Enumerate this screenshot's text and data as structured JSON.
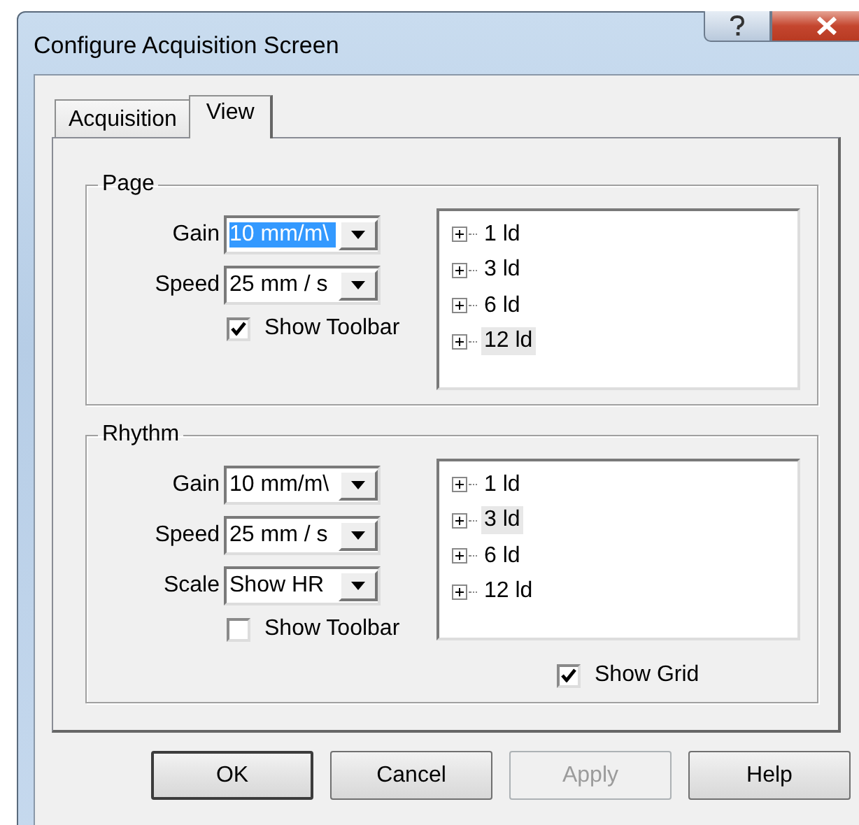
{
  "window": {
    "title": "Configure Acquisition Screen"
  },
  "tabs": [
    {
      "label": "Acquisition",
      "selected": false
    },
    {
      "label": "View",
      "selected": true
    }
  ],
  "groups": [
    {
      "title": "Page",
      "fields": [
        {
          "label": "Gain",
          "value": "10 mm/m\\",
          "focused": true
        },
        {
          "label": "Speed",
          "value": "25 mm / s",
          "focused": false
        }
      ],
      "show_toolbar": {
        "label": "Show Toolbar",
        "checked": true
      },
      "tree": [
        {
          "label": "1 ld",
          "expanded": false,
          "selected": false
        },
        {
          "label": "3 ld",
          "expanded": false,
          "selected": false
        },
        {
          "label": "6 ld",
          "expanded": false,
          "selected": false
        },
        {
          "label": "12 ld",
          "expanded": false,
          "selected": true
        }
      ]
    },
    {
      "title": "Rhythm",
      "fields": [
        {
          "label": "Gain",
          "value": "10 mm/m\\",
          "focused": false
        },
        {
          "label": "Speed",
          "value": "25 mm / s",
          "focused": false
        },
        {
          "label": "Scale",
          "value": "Show HR",
          "focused": false
        }
      ],
      "show_toolbar": {
        "label": "Show Toolbar",
        "checked": false
      },
      "tree": [
        {
          "label": "1 ld",
          "expanded": false,
          "selected": false
        },
        {
          "label": "3 ld",
          "expanded": false,
          "selected": true
        },
        {
          "label": "6 ld",
          "expanded": false,
          "selected": false
        },
        {
          "label": "12 ld",
          "expanded": false,
          "selected": false
        }
      ],
      "show_grid": {
        "label": "Show Grid",
        "checked": true
      }
    }
  ],
  "buttons": [
    {
      "label": "OK",
      "default": true,
      "disabled": false
    },
    {
      "label": "Cancel",
      "default": false,
      "disabled": false
    },
    {
      "label": "Apply",
      "default": false,
      "disabled": true
    },
    {
      "label": "Help",
      "default": false,
      "disabled": false
    }
  ]
}
